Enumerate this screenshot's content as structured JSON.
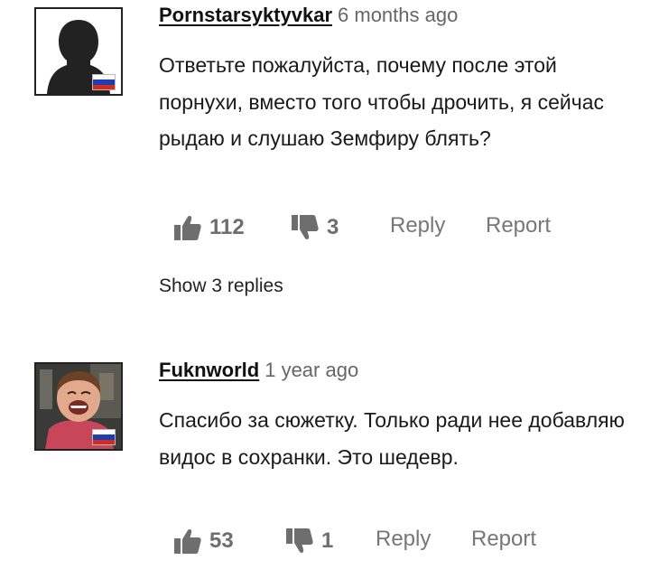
{
  "comments": [
    {
      "author": "Pornstarsyktyvkar",
      "time": "6 months ago",
      "body": "Ответьте пожалуйста, почему после этой порнухи, вместо того чтобы дрочить, я сейчас рыдаю и слушаю Земфиру блять?",
      "likes": "112",
      "dislikes": "3",
      "reply_label": "Reply",
      "report_label": "Report",
      "show_replies": "Show 3 replies",
      "avatar": "default-silhouette-avatar",
      "flag": "russia-flag"
    },
    {
      "author": "Fuknworld",
      "time": "1 year ago",
      "body": "Спасибо за сюжетку. Только ради нее добавляю видос в сохранки. Это шедевр.",
      "likes": "53",
      "dislikes": "1",
      "reply_label": "Reply",
      "report_label": "Report",
      "avatar": "photo-avatar-laughing-man",
      "flag": "russia-flag"
    }
  ],
  "icons": {
    "like": "thumbs-up-icon",
    "dislike": "thumbs-down-icon"
  },
  "colors": {
    "text": "#1a1a1a",
    "secondary": "#777777",
    "flag_white": "#ffffff",
    "flag_blue": "#1c3fb0",
    "flag_red": "#d52b1e"
  }
}
